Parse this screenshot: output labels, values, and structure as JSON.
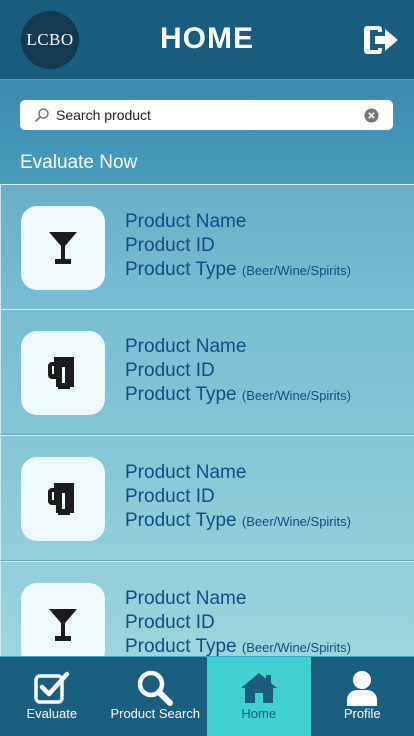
{
  "header": {
    "logo_text": "LCBO",
    "title": "HOME",
    "logout_icon": "logout-icon"
  },
  "search": {
    "placeholder": "Search product",
    "value": "",
    "search_icon": "search-icon",
    "clear_icon": "clear-icon"
  },
  "section": {
    "title": "Evaluate Now"
  },
  "products": [
    {
      "icon": "cocktail-glass-icon",
      "name": "Product Name",
      "id": "Product ID",
      "type_label": "Product Type",
      "type_hint": "(Beer/Wine/Spirits)"
    },
    {
      "icon": "beer-mug-icon",
      "name": "Product Name",
      "id": "Product ID",
      "type_label": "Product Type",
      "type_hint": "(Beer/Wine/Spirits)"
    },
    {
      "icon": "beer-mug-icon",
      "name": "Product Name",
      "id": "Product ID",
      "type_label": "Product Type",
      "type_hint": "(Beer/Wine/Spirits)"
    },
    {
      "icon": "cocktail-glass-icon",
      "name": "Product Name",
      "id": "Product ID",
      "type_label": "Product Type",
      "type_hint": "(Beer/Wine/Spirits)"
    }
  ],
  "tabbar": {
    "active": "Home",
    "tabs": [
      {
        "label": "Evaluate",
        "icon": "checkbox-icon"
      },
      {
        "label": "Product Search",
        "icon": "magnifier-icon"
      },
      {
        "label": "Home",
        "icon": "home-icon"
      },
      {
        "label": "Profile",
        "icon": "person-icon"
      }
    ]
  },
  "colors": {
    "header_bg": "#1a5c7e",
    "active_tab": "#3fd0cf",
    "product_text": "#124c85"
  }
}
